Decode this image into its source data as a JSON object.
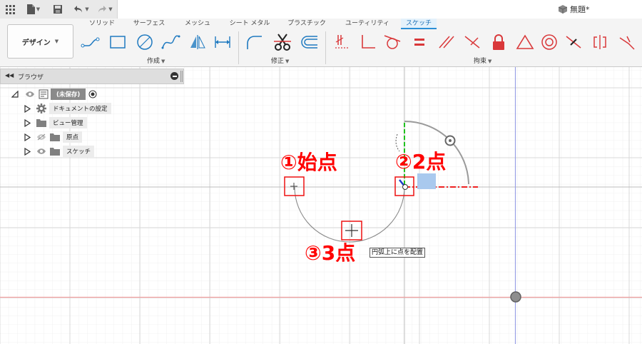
{
  "appbar": {
    "document_title": "無題*",
    "icons": [
      "grid-menu-icon",
      "file-icon",
      "save-icon",
      "undo-icon",
      "redo-icon",
      "cube-icon"
    ]
  },
  "ribbon": {
    "design_button": "デザイン",
    "tabs": [
      "ソリッド",
      "サーフェス",
      "メッシュ",
      "シート メタル",
      "プラスチック",
      "ユーティリティ",
      "スケッチ"
    ],
    "active_tab": "スケッチ",
    "groups": {
      "create": "作成",
      "modify": "修正",
      "constraints": "拘束"
    }
  },
  "browser": {
    "title": "ブラウザ",
    "root": "(未保存)",
    "items": [
      "ドキュメントの設定",
      "ビュー管理",
      "原点",
      "スケッチ"
    ]
  },
  "annotations": {
    "start_point": "①始点",
    "second_point": "②2点",
    "third_point": "③3点"
  },
  "tooltip": "円弧上に点を配置",
  "colors": {
    "annotation_red": "#ff0000",
    "active_tab_blue": "#2a8fd6",
    "constraint_red": "#d9383a",
    "axis_red": "#f0a0a0",
    "axis_blue": "#9aa0e6"
  }
}
